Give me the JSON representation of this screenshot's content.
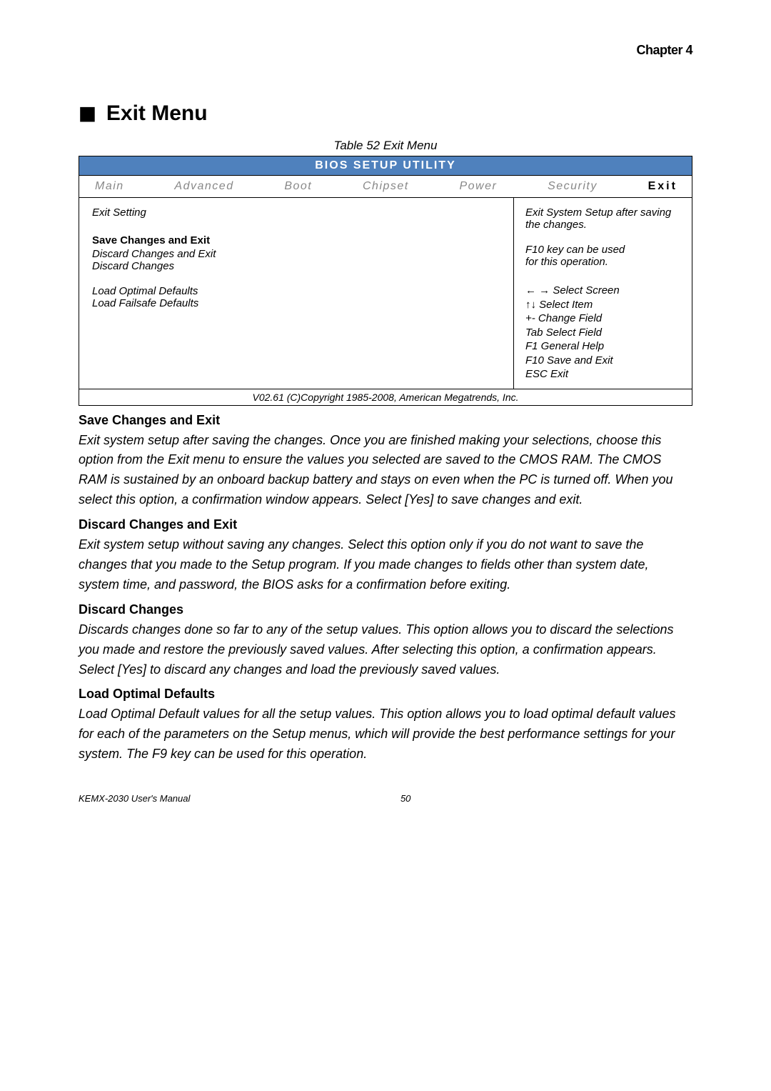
{
  "chapter": "Chapter  4",
  "heading": "Exit Menu",
  "table_caption": "Table 52 Exit Menu",
  "bios": {
    "title": "BIOS SETUP UTILITY",
    "tabs": {
      "main": "Main",
      "advanced": "Advanced",
      "boot": "Boot",
      "chipset": "Chipset",
      "power": "Power",
      "security": "Security",
      "exit": "Exit"
    },
    "left": {
      "exit_setting": "Exit Setting",
      "save_changes_and_exit": "Save Changes and Exit",
      "discard_changes_and_exit": "Discard Changes and Exit",
      "discard_changes": "Discard Changes",
      "load_optimal_defaults": "Load Optimal Defaults",
      "load_failsafe_defaults": "Load Failsafe Defaults"
    },
    "right": {
      "line1": "Exit System Setup after saving",
      "line2": "the changes.",
      "line3": "F10 key can be used",
      "line4": "for this operation.",
      "help1": "← → Select Screen",
      "help2": "↑↓  Select Item",
      "help3": "+- Change Field",
      "help4": "Tab Select Field",
      "help5": "F1 General Help",
      "help6": "F10 Save and Exit",
      "help7": "ESC Exit"
    },
    "footer": "V02.61 (C)Copyright 1985-2008, American Megatrends, Inc."
  },
  "sections": {
    "s1_h": "Save Changes and Exit",
    "s1_b": "Exit system setup after saving the changes. Once you are finished making your selections, choose this option from the Exit menu to ensure the values you selected are saved to the CMOS RAM. The CMOS RAM is sustained by an onboard backup battery and stays on even when the PC is turned off. When you select this option, a confirmation window appears. Select [Yes] to save changes and exit.",
    "s2_h": "Discard Changes and Exit",
    "s2_b": "Exit system setup without saving any changes. Select this option only if you do not want to save the changes that you made to the Setup program. If you made changes to fields other than system date, system time, and password, the BIOS asks for a confirmation before exiting.",
    "s3_h": "Discard Changes",
    "s3_b": "Discards changes done so far to any of the setup values. This option allows you to discard the selections you made and restore the previously saved values. After selecting this option, a confirmation appears. Select [Yes] to discard any changes and load the previously saved values.",
    "s4_h": "Load Optimal Defaults",
    "s4_b": "Load Optimal Default values for all the setup values. This option allows you to load optimal default values for each of the parameters on the Setup menus, which will provide the best performance settings for your system. The F9 key can be used for this operation."
  },
  "footer": {
    "left": "KEMX-2030 User's Manual",
    "right": "50"
  }
}
